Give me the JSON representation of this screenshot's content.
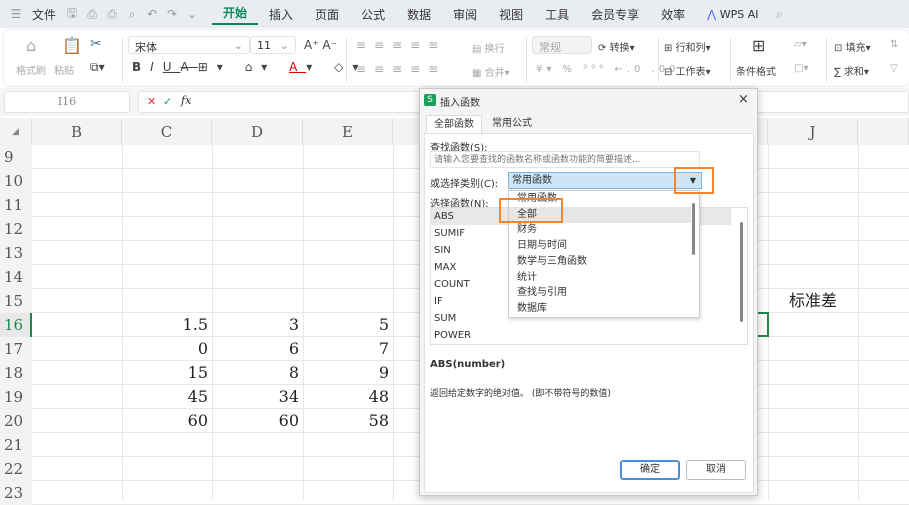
{
  "topbar": {
    "menu": "文件",
    "tabs": [
      "开始",
      "插入",
      "页面",
      "公式",
      "数据",
      "审阅",
      "视图",
      "工具",
      "会员专享",
      "效率"
    ],
    "active_tab": "开始",
    "ai": "WPS AI"
  },
  "ribbon": {
    "format_painter": "格式刷",
    "paste": "粘贴",
    "font": "宋体",
    "font_size": "11",
    "wrap": "换行",
    "merge": "合并",
    "number_format": "常规",
    "convert": "转换",
    "rows_cols": "行和列",
    "worksheet": "工作表",
    "cond_format": "条件格式",
    "fill": "填充",
    "sum": "求和"
  },
  "formula_bar": {
    "cell_ref": "I16",
    "fx": "fx",
    "value": ""
  },
  "columns": [
    "B",
    "C",
    "D",
    "E",
    "J"
  ],
  "rows": [
    "9",
    "10",
    "11",
    "12",
    "13",
    "14",
    "15",
    "16",
    "17",
    "18",
    "19",
    "20",
    "21",
    "22",
    "23"
  ],
  "cells": {
    "C": [
      "1.5",
      "0",
      "15",
      "45",
      "60"
    ],
    "D": [
      "3",
      "6",
      "8",
      "34",
      "60"
    ],
    "E": [
      "5",
      "7",
      "9",
      "48",
      "58"
    ]
  },
  "j15": "标准差",
  "dialog": {
    "title": "插入函数",
    "tabs": [
      "全部函数",
      "常用公式"
    ],
    "search_label": "查找函数(S):",
    "search_placeholder": "请输入您要查找的函数名称或函数功能的简要描述...",
    "category_label": "或选择类别(C):",
    "category_value": "常用函数",
    "function_label": "选择函数(N):",
    "functions": [
      "ABS",
      "SUMIF",
      "SIN",
      "MAX",
      "COUNT",
      "IF",
      "SUM",
      "POWER"
    ],
    "categories": [
      "常用函数",
      "全部",
      "财务",
      "日期与时间",
      "数学与三角函数",
      "统计",
      "查找与引用",
      "数据库"
    ],
    "highlighted_category": "全部",
    "signature": "ABS(number)",
    "description": "返回给定数字的绝对值。 (即不带符号的数值)",
    "ok": "确定",
    "cancel": "取消",
    "close": "×"
  },
  "colors": {
    "accent": "#0a8a5a",
    "highlight": "#f5842a",
    "selected": "#cde6f7"
  }
}
